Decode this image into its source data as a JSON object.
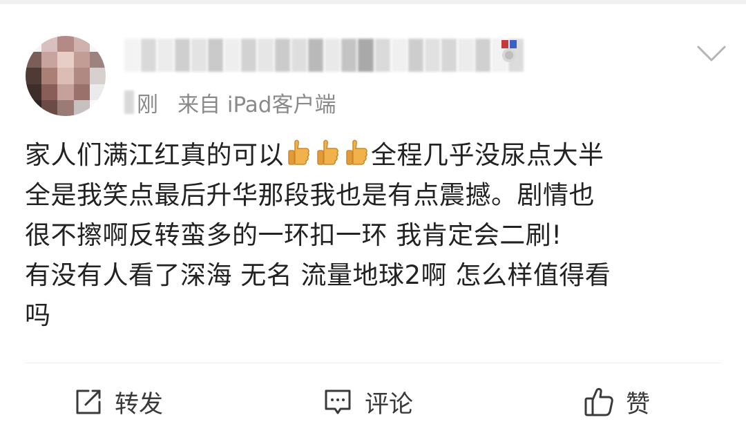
{
  "post": {
    "meta_time_suffix": "刚",
    "meta_source": "来自 iPad客户端",
    "text_lines": [
      "家人们满江红真的可以",
      "全程几乎没尿点大半",
      "全是我笑点最后升华那段我也是有点震撼。剧情也",
      "很不擦啊反转蛮多的一环扣一环 我肯定会二刷!",
      "有没有人看了深海 无名 流量地球2啊 怎么样值得看",
      "吗"
    ],
    "emoji": "thumbs-up-icon"
  },
  "actions": {
    "repost_label": "转发",
    "comment_label": "评论",
    "like_label": "赞"
  },
  "colors": {
    "text": "#222222",
    "meta": "#8a8a8a",
    "action_text": "#3a3a3a",
    "divider": "#ececec",
    "thumb": "#f2b24b"
  }
}
